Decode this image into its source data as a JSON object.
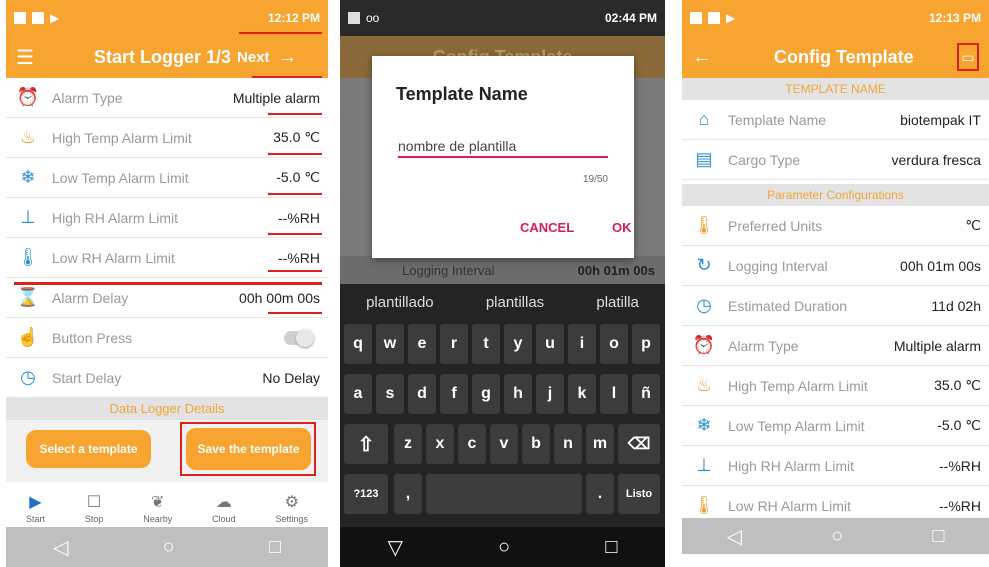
{
  "colors": {
    "accent": "#f7a530",
    "highlight": "#e0201e",
    "dialog_accent": "#d81b60"
  },
  "screen1": {
    "status_time": "12:12 PM",
    "title": "Start Logger 1/3",
    "next_label": "Next",
    "rows": [
      {
        "icon": "alarm-icon",
        "label": "Alarm Type",
        "value": "Multiple alarm"
      },
      {
        "icon": "flame-icon",
        "label": "High Temp Alarm Limit",
        "value": "35.0 ℃"
      },
      {
        "icon": "snowflake-icon",
        "label": "Low Temp Alarm Limit",
        "value": "-5.0 ℃"
      },
      {
        "icon": "humidity-high-icon",
        "label": "High RH Alarm Limit",
        "value": "--%RH"
      },
      {
        "icon": "humidity-low-icon",
        "label": "Low RH Alarm Limit",
        "value": "--%RH"
      },
      {
        "icon": "hourglass-icon",
        "label": "Alarm Delay",
        "value": "00h 00m 00s"
      },
      {
        "icon": "hand-press-icon",
        "label": "Button Press",
        "value": ""
      },
      {
        "icon": "timer-icon",
        "label": "Start Delay",
        "value": "No Delay"
      }
    ],
    "section_title": "Data Logger Details",
    "select_button": "Select a template",
    "save_button": "Save the template",
    "tabs": [
      {
        "icon": "play-icon",
        "label": "Start"
      },
      {
        "icon": "stop-icon",
        "label": "Stop"
      },
      {
        "icon": "leaf-icon",
        "label": "Nearby"
      },
      {
        "icon": "cloud-icon",
        "label": "Cloud"
      },
      {
        "icon": "gear-icon",
        "label": "Settings"
      }
    ]
  },
  "screen2": {
    "status_time": "02:44 PM",
    "bg_title": "Config Template",
    "bg_row_label": "Logging Interval",
    "bg_row_value": "00h 01m 00s",
    "dialog_title": "Template Name",
    "input_value": "nombre de plantilla",
    "counter": "19/50",
    "cancel": "CANCEL",
    "ok": "OK",
    "suggestions": [
      "plantillado",
      "plantillas",
      "platilla"
    ],
    "row1": [
      "q",
      "w",
      "e",
      "r",
      "t",
      "y",
      "u",
      "i",
      "o",
      "p"
    ],
    "row2": [
      "a",
      "s",
      "d",
      "f",
      "g",
      "h",
      "j",
      "k",
      "l",
      "ñ"
    ],
    "row3": [
      "z",
      "x",
      "c",
      "v",
      "b",
      "n",
      "m"
    ],
    "sym_key": "?123",
    "comma_key": ",",
    "period_key": ".",
    "done_key": "Listo"
  },
  "screen3": {
    "status_time": "12:13 PM",
    "title": "Config Template",
    "section1": "TEMPLATE NAME",
    "rows1": [
      {
        "icon": "tag-icon",
        "label": "Template Name",
        "value": "biotempak IT"
      },
      {
        "icon": "cargo-icon",
        "label": "Cargo Type",
        "value": "verdura fresca"
      }
    ],
    "section2": "Parameter Configurations",
    "rows2": [
      {
        "icon": "thermometer-icon",
        "label": "Preferred Units",
        "value": "℃"
      },
      {
        "icon": "interval-icon",
        "label": "Logging Interval",
        "value": "00h 01m 00s"
      },
      {
        "icon": "clock-icon",
        "label": "Estimated Duration",
        "value": "11d 02h"
      },
      {
        "icon": "alarm-icon",
        "label": "Alarm Type",
        "value": "Multiple alarm"
      },
      {
        "icon": "flame-icon",
        "label": "High Temp Alarm Limit",
        "value": "35.0 ℃"
      },
      {
        "icon": "snowflake-icon",
        "label": "Low Temp Alarm Limit",
        "value": "-5.0 ℃"
      },
      {
        "icon": "humidity-high-icon",
        "label": "High RH Alarm Limit",
        "value": "--%RH"
      },
      {
        "icon": "humidity-low-icon",
        "label": "Low RH Alarm Limit",
        "value": "--%RH"
      }
    ]
  }
}
